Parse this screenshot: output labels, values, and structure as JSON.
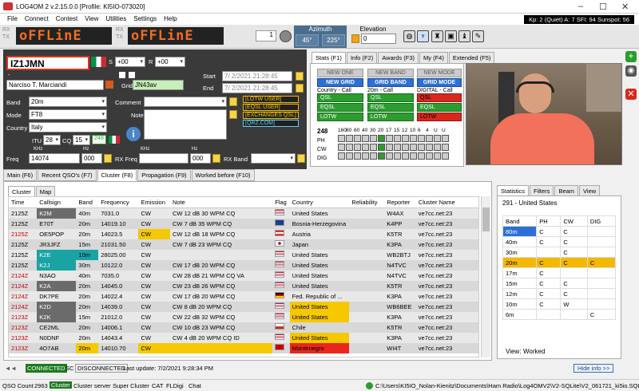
{
  "window": {
    "title": "LOG4OM 2 v.2.15.0.0 [Profile: KI5IO-073020]",
    "min": "–",
    "max": "☐",
    "close": "✕"
  },
  "menu": [
    "File",
    "Connect",
    "Contest",
    "View",
    "Utilities",
    "Settings",
    "Help"
  ],
  "propagation": "Kp: 2 (Quiet)  A: 7  SFI: 94  Sunspot: 56",
  "toolbar": {
    "rx": "RX",
    "tx": "TX",
    "display": "oFFLinE",
    "spin": "1",
    "azimuth_label": "Azimuth",
    "az1": "45°",
    "az2": "225°",
    "elev_label": "Elevation",
    "elev": "0"
  },
  "qso": {
    "callsign": "IZ1JMN",
    "s_label": "S",
    "s_val": "+00",
    "r_label": "R",
    "r_val": "+00",
    "dash": "-",
    "name": "Narciso T. Marciandi",
    "grid_label": "Grid",
    "grid": "JN43av",
    "start_label": "Start",
    "start": "7/ 2/2021 21:28:45",
    "end_label": "End",
    "end": "7/ 2/2021 21:28:45",
    "band_label": "Band",
    "band": "20m",
    "mode_label": "Mode",
    "mode": "FT8",
    "country_label": "Country",
    "country": "Italy",
    "itu_label": "ITU",
    "itu": "28",
    "cq_label": "CQ",
    "cq": "15",
    "dxcc": "248",
    "comment_label": "Comment",
    "note_label": "Note",
    "tags": [
      "[LOTW USER]",
      "[EQSL USER]",
      "[EXCHANGES QSL]",
      "[QRZ.COM]"
    ],
    "freq_label": "Freq",
    "khz": "KHz",
    "hz": "Hz",
    "freq": "14074",
    "freq_hz": "000",
    "rxfreq_label": "RX Freq",
    "rxfreq_hz": "000",
    "rxband_label": "RX Band"
  },
  "stats_tabs": [
    "Stats (F1)",
    "Info (F2)",
    "Awards (F3)",
    "My (F4)",
    "Extended (F5)"
  ],
  "stats": {
    "cols": [
      {
        "top": "NEW ONE",
        "sub": "NEW GRID",
        "desc": "Country - Call",
        "qsl": "QSL",
        "eqsl": "EQSL",
        "lotw": "LOTW",
        "c": [
          "grn",
          "grn",
          "grn"
        ]
      },
      {
        "top": "NEW BAND",
        "sub": "GRID BAND",
        "desc": "20m - Call",
        "qsl": "QSL",
        "eqsl": "EQSL",
        "lotw": "LOTW",
        "c": [
          "grn",
          "grn",
          "grn"
        ]
      },
      {
        "top": "NEW MODE",
        "sub": "GRID MODE",
        "desc": "DIGITAL - Call",
        "qsl": "QSL",
        "eqsl": "EQSL",
        "lotw": "LOTW",
        "c": [
          "red",
          "grn",
          "red"
        ]
      }
    ],
    "dxcc": "248",
    "bands": [
      "160",
      "80",
      "60",
      "40",
      "30",
      "20",
      "17",
      "15",
      "12",
      "10",
      "6",
      "4",
      "U",
      "U"
    ],
    "rows": [
      "PH",
      "CW",
      "DIG"
    ]
  },
  "lower_tabs": [
    "Main (F6)",
    "Recent QSO's (F7)",
    "Cluster (F8)",
    "Propagation (F9)",
    "Worked before (F10)"
  ],
  "cluster_tabs": [
    "Cluster",
    "Map"
  ],
  "cluster": {
    "headers": [
      "Time",
      "Callsign",
      "Band",
      "Frequency",
      "Emission",
      "Note",
      "Flag",
      "Country",
      "Reliability",
      "Reporter",
      "Cluster Name"
    ],
    "rows": [
      [
        "2125Z",
        "K2M",
        "40m",
        "7031.0",
        "CW",
        "CW 12 dB 30 WPM CQ",
        "us",
        "United States",
        "",
        "W4AX",
        "ve7cc.net:23"
      ],
      [
        "2125Z",
        "E70T",
        "20m",
        "14019.10",
        "CW",
        "CW  7 dB 35 WPM CQ",
        "ba",
        "Bosnia-Herzegovina",
        "",
        "K4PP",
        "ve7cc.net:23"
      ],
      [
        "2125Z",
        "OE5POP",
        "20m",
        "14023.5",
        "CW",
        "CW 12 dB 18 WPM CQ",
        "at",
        "Austria",
        "",
        "K5TR",
        "ve7cc.net:23"
      ],
      [
        "2125Z",
        "JR3JFZ",
        "15m",
        "21031.50",
        "CW",
        "CW  7 dB 23 WPM CQ",
        "jp",
        "Japan",
        "",
        "K3PA",
        "ve7cc.net:23"
      ],
      [
        "2125Z",
        "K2E",
        "10m",
        "28025.00",
        "CW",
        "",
        "us",
        "United States",
        "",
        "WB2BTJ",
        "ve7cc.net:23"
      ],
      [
        "2125Z",
        "K2J",
        "30m",
        "10122.0",
        "CW",
        "CW 17 dB 20 WPM CQ",
        "us",
        "United States",
        "",
        "N4TVC",
        "ve7cc.net:23"
      ],
      [
        "2124Z",
        "N3AO",
        "40m",
        "7035.0",
        "CW",
        "CW 28 dB 21 WPM CQ        VA",
        "us",
        "United States",
        "",
        "N4TVC",
        "ve7cc.net:23"
      ],
      [
        "2124Z",
        "K2A",
        "20m",
        "14045.0",
        "CW",
        "CW 23 dB 26 WPM CQ",
        "us",
        "United States",
        "",
        "K5TR",
        "ve7cc.net:23"
      ],
      [
        "2124Z",
        "DK7PE",
        "20m",
        "14022.4",
        "CW",
        "CW 17 dB 20 WPM CQ",
        "de",
        "Fed. Republic of ...",
        "",
        "K3PA",
        "ve7cc.net:23"
      ],
      [
        "2124Z",
        "K2D",
        "20m",
        "14039.0",
        "CW",
        "CW  8 dB 20 WPM CQ",
        "us",
        "United States",
        "",
        "WB6BEE",
        "ve7cc.net:23"
      ],
      [
        "2123Z",
        "K2K",
        "15m",
        "21012.0",
        "CW",
        "CW 22 dB 32 WPM CQ",
        "us",
        "United States",
        "",
        "K3PA",
        "ve7cc.net:23"
      ],
      [
        "2123Z",
        "CE2ML",
        "20m",
        "14006.1",
        "CW",
        "CW 10 dB 23 WPM CQ",
        "cl",
        "Chile",
        "",
        "K5TR",
        "ve7cc.net:23"
      ],
      [
        "2123Z",
        "N0DNF",
        "20m",
        "14043.4",
        "CW",
        "CW  4 dB 20 WPM CQ        ID",
        "us",
        "United States",
        "",
        "K3PA",
        "ve7cc.net:23"
      ],
      [
        "2123Z",
        "4O7AB",
        "20m",
        "14010.70",
        "CW",
        "",
        "me",
        "Montenegro",
        "",
        "WI4T",
        "ve7cc.net:23"
      ]
    ]
  },
  "right": {
    "tabs": [
      "Statistics",
      "Filters",
      "Beam",
      "View"
    ],
    "count": "291 - United States",
    "headers": [
      "Band",
      "PH",
      "CW",
      "DIG"
    ],
    "rows": [
      [
        "80m",
        "C",
        "C",
        ""
      ],
      [
        "40m",
        "C",
        "C",
        ""
      ],
      [
        "30m",
        "",
        "C",
        ""
      ],
      [
        "20m",
        "C",
        "C",
        "C"
      ],
      [
        "17m",
        "C",
        "",
        ""
      ],
      [
        "15m",
        "C",
        "C",
        ""
      ],
      [
        "12m",
        "C",
        "C",
        ""
      ],
      [
        "10m",
        "C",
        "W",
        ""
      ],
      [
        "6m",
        "",
        "",
        "C"
      ]
    ],
    "view_label": "View:",
    "view": "Worked"
  },
  "status": {
    "connected": "CONNECTED",
    "sc": "SC",
    "disconnected": "DISCONNECTED",
    "update": "Last update:  7/2/2021 9:28:34 PM",
    "hide": "Hide info >>"
  },
  "bottom": {
    "qso_label": "QSO Count",
    "qso": "2963",
    "items": [
      "Cluster",
      "Cluster server",
      "Super Cluster",
      "CAT",
      "FLDigi",
      "Chat"
    ],
    "path": "C:\\Users\\KI5IO_Nolan-Kienitz\\Documents\\Ham Radio\\Log4OMV2\\V2-SQLite\\V2_061721_ki5io.SQLite"
  }
}
